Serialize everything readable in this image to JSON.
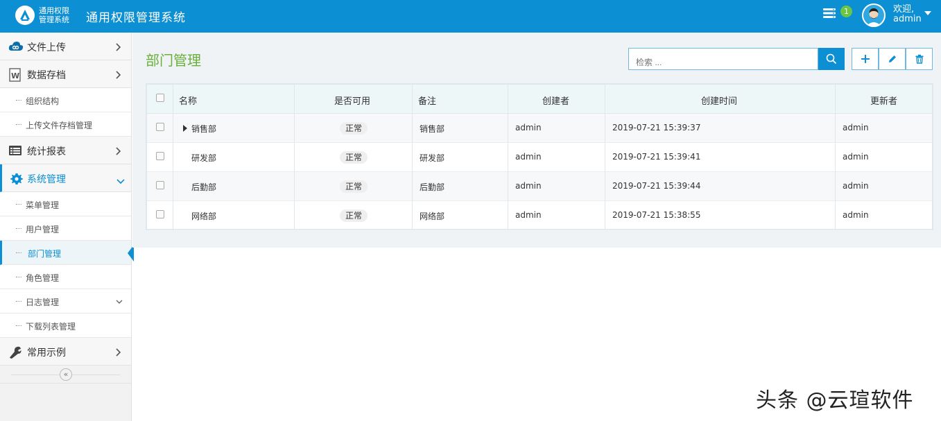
{
  "header": {
    "logo_line1": "通用权限",
    "logo_line2": "管理系统",
    "title": "通用权限管理系统",
    "message_icon": "message-list-icon",
    "message_count": "1",
    "welcome_line1": "欢迎,",
    "welcome_line2": "admin",
    "accent": "#0c8fd3"
  },
  "sidebar": {
    "groups": [
      {
        "label": "文件上传",
        "icon": "cloud-icon"
      },
      {
        "label": "数据存档",
        "icon": "word-doc-icon"
      },
      {
        "label": "统计报表",
        "icon": "report-icon"
      },
      {
        "label": "系统管理",
        "icon": "gear-icon"
      },
      {
        "label": "常用示例",
        "icon": "wrench-icon"
      }
    ],
    "archive_items": [
      {
        "label": "组织结构"
      },
      {
        "label": "上传文件存档管理"
      }
    ],
    "system_items": [
      {
        "label": "菜单管理"
      },
      {
        "label": "用户管理"
      },
      {
        "label": "部门管理"
      },
      {
        "label": "角色管理"
      },
      {
        "label": "日志管理"
      },
      {
        "label": "下载列表管理"
      }
    ],
    "collapse_glyph": "«"
  },
  "main": {
    "title": "部门管理",
    "search_placeholder": "检索 ...",
    "title_color": "#6aaf3a"
  },
  "table": {
    "columns": [
      "名称",
      "是否可用",
      "备注",
      "创建者",
      "创建时间",
      "更新者"
    ],
    "rows": [
      {
        "name": "销售部",
        "status": "正常",
        "remark": "销售部",
        "creator": "admin",
        "created": "2019-07-21 15:39:37",
        "updater": "admin"
      },
      {
        "name": "研发部",
        "status": "正常",
        "remark": "研发部",
        "creator": "admin",
        "created": "2019-07-21 15:39:41",
        "updater": "admin"
      },
      {
        "name": "后勤部",
        "status": "正常",
        "remark": "后勤部",
        "creator": "admin",
        "created": "2019-07-21 15:39:44",
        "updater": "admin"
      },
      {
        "name": "网络部",
        "status": "正常",
        "remark": "网络部",
        "creator": "admin",
        "created": "2019-07-21 15:38:55",
        "updater": "admin"
      }
    ]
  },
  "watermark": "头条 @云瑄软件"
}
